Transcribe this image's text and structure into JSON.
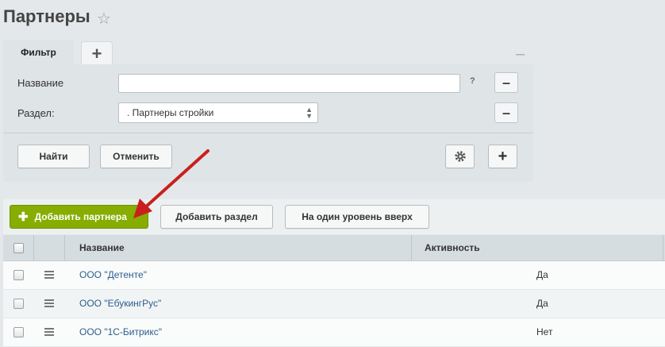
{
  "page": {
    "title": "Партнеры"
  },
  "filter": {
    "tab_label": "Фильтр",
    "add_tab_label": "+",
    "collapse_label": "–",
    "fields": [
      {
        "label": "Название",
        "value": "",
        "help": "?"
      },
      {
        "label": "Раздел:",
        "value": ". Партнеры стройки"
      }
    ],
    "remove_label": "–",
    "find_label": "Найти",
    "cancel_label": "Отменить",
    "add_field_label": "+"
  },
  "toolbar": {
    "add_partner_label": "Добавить партнера",
    "add_section_label": "Добавить раздел",
    "level_up_label": "На один уровень вверх"
  },
  "grid": {
    "columns": [
      "Название",
      "Активность"
    ],
    "rows": [
      {
        "name": "ООО \"Детенте\"",
        "active": "Да"
      },
      {
        "name": "ООО \"ЕбукингРус\"",
        "active": "Да"
      },
      {
        "name": "ООО \"1С-Битрикс\"",
        "active": "Нет"
      }
    ]
  },
  "colors": {
    "accent_green": "#86ad00",
    "arrow_red": "#c8201d",
    "link_blue": "#2b5e8c"
  }
}
